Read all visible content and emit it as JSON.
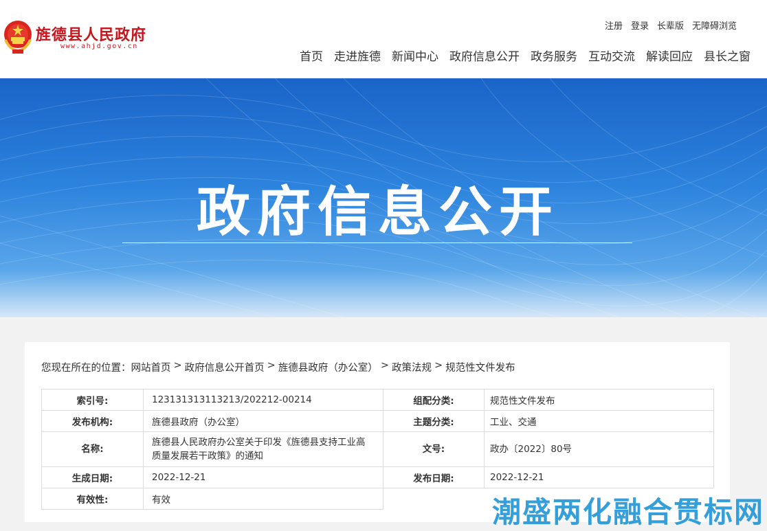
{
  "header": {
    "site_name": "旌德县人民政府",
    "site_url": "www.ahjd.gov.cn",
    "top_links": [
      "注册",
      "登录",
      "长辈版",
      "无障碍浏览"
    ],
    "nav": [
      "首页",
      "走进旌德",
      "新闻中心",
      "政府信息公开",
      "政务服务",
      "互动交流",
      "解读回应",
      "县长之窗"
    ]
  },
  "banner": {
    "title": "政府信息公开"
  },
  "breadcrumb": {
    "prefix": "您现在所在的位置：",
    "items": [
      "网站首页",
      "政府信息公开首页",
      "旌德县政府（办公室）",
      "政策法规",
      "规范性文件发布"
    ],
    "separators": [
      ">",
      ">",
      ">",
      ">"
    ]
  },
  "meta": {
    "index_label": "索引号:",
    "index_value": "123131313113213/202212-00214",
    "category_label": "组配分类:",
    "category_value": "规范性文件发布",
    "publisher_label": "发布机构:",
    "publisher_value": "旌德县政府（办公室）",
    "topic_label": "主题分类:",
    "topic_value": "工业、交通",
    "name_label": "名称:",
    "name_value_line1": "旌德县人民政府办公室关于印发《旌德县支持工业高",
    "name_value_line2": "质量发展若干政策》的通知",
    "docno_label": "文号:",
    "docno_value": "政办〔2022〕80号",
    "created_label": "生成日期:",
    "created_value": "2022-12-21",
    "published_label": "发布日期:",
    "published_value": "2022-12-21",
    "validity_label": "有效性:",
    "validity_value": "有效"
  },
  "watermark": "潮盛两化融合贯标网"
}
